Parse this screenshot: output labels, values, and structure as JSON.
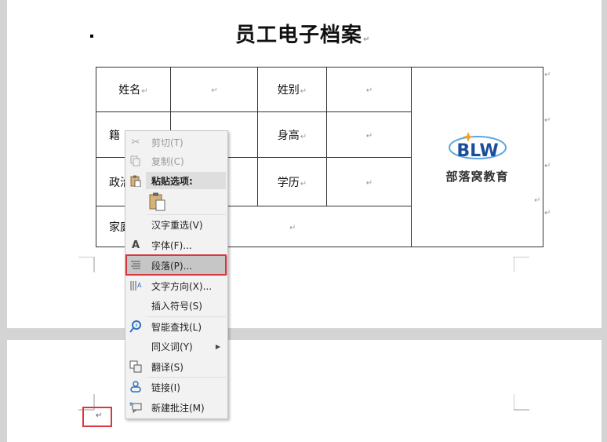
{
  "document": {
    "title": "员工电子档案",
    "paragraph_mark": "↵",
    "table": {
      "r1": {
        "c1": "姓名",
        "c3": "姓别"
      },
      "r2": {
        "c1": "籍",
        "c3": "身高"
      },
      "r3": {
        "c1": "政治",
        "c3": "学历"
      },
      "r4": {
        "c1": "家庭"
      }
    },
    "logo": {
      "mark": "BLW",
      "text": "部落窝教育"
    }
  },
  "context_menu": {
    "cut": {
      "label": "剪切(T)",
      "enabled": false,
      "icon": "scissors-icon"
    },
    "copy": {
      "label": "复制(C)",
      "enabled": false,
      "icon": "copy-icon"
    },
    "paste_options": {
      "label": "粘贴选项:",
      "icon": "clipboard-icon"
    },
    "hanzi_reselect": {
      "label": "汉字重选(V)"
    },
    "font": {
      "label": "字体(F)...",
      "icon": "font-A-icon",
      "glyph": "A"
    },
    "paragraph": {
      "label": "段落(P)...",
      "icon": "paragraph-icon",
      "highlighted": true
    },
    "text_direction": {
      "label": "文字方向(X)...",
      "icon": "text-direction-icon"
    },
    "insert_symbol": {
      "label": "插入符号(S)"
    },
    "smart_lookup": {
      "label": "智能查找(L)",
      "icon": "smart-lookup-icon"
    },
    "synonyms": {
      "label": "同义词(Y)",
      "has_submenu": true
    },
    "translate": {
      "label": "翻译(S)",
      "icon": "translate-icon"
    },
    "link": {
      "label": "链接(I)",
      "icon": "link-icon"
    },
    "new_comment": {
      "label": "新建批注(M)",
      "icon": "new-comment-icon"
    }
  },
  "colors": {
    "highlight_border": "#d9373e",
    "menu_bg": "#f2f2f2",
    "page_bg": "#d4d4d4"
  }
}
